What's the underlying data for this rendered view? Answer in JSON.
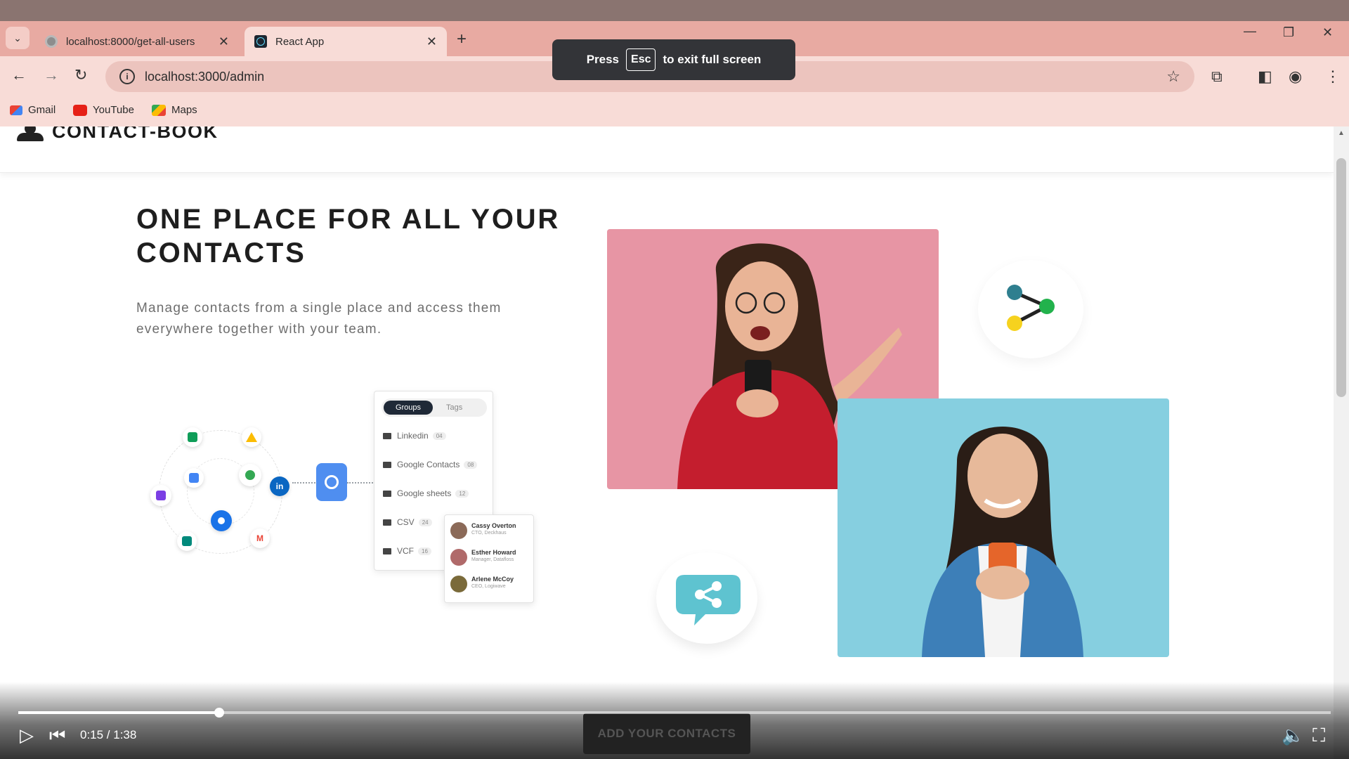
{
  "browser": {
    "tabs": [
      {
        "title": "localhost:8000/get-all-users",
        "active": false
      },
      {
        "title": "React App",
        "active": true
      }
    ],
    "new_tab_icon": "plus-icon",
    "address": "localhost:3000/admin",
    "bookmarks": [
      "Gmail",
      "YouTube",
      "Maps"
    ]
  },
  "fullscreen_tip": {
    "before": "Press",
    "key": "Esc",
    "after": "to exit full screen"
  },
  "app": {
    "logo_text": "CONTACT-BOOK",
    "headline": "ONE PLACE FOR ALL YOUR CONTACTS",
    "subtext": "Manage contacts from a single place and access them everywhere together with your team.",
    "cta": "ADD YOUR CONTACTS"
  },
  "groups_card": {
    "tabs": [
      "Groups",
      "Tags"
    ],
    "rows": [
      {
        "label": "Linkedin",
        "count": "04"
      },
      {
        "label": "Google Contacts",
        "count": "08"
      },
      {
        "label": "Google sheets",
        "count": "12"
      },
      {
        "label": "CSV",
        "count": "24"
      },
      {
        "label": "VCF",
        "count": "16"
      }
    ]
  },
  "people_card": [
    {
      "name": "Cassy Overton",
      "role": "CTO, Deckhaus"
    },
    {
      "name": "Esther Howard",
      "role": "Manager, Datafloss"
    },
    {
      "name": "Arlene McCoy",
      "role": "CEO, Logiwave"
    }
  ],
  "video": {
    "time": "0:15 / 1:38",
    "progress": 0.1531
  },
  "colors": {
    "tab_bar": "#e8aaa2",
    "toolbar": "#f8dcd7",
    "photo_pink": "#e795a4",
    "photo_blue": "#86cfe0",
    "share_teal": "#2f7f8f",
    "share_green": "#22b24c",
    "share_yellow": "#f6d21e",
    "chat_teal": "#5ec3d0"
  }
}
